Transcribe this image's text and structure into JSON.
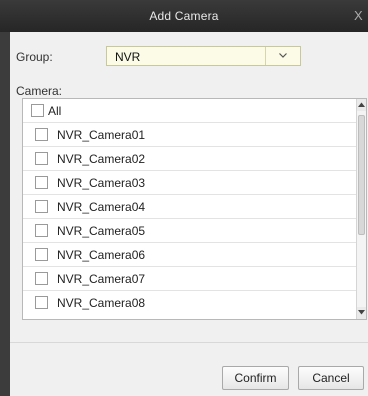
{
  "dialog": {
    "title": "Add Camera",
    "close_glyph": "X"
  },
  "group": {
    "label": "Group:",
    "value": "NVR"
  },
  "camera": {
    "label": "Camera:",
    "all_label": "All",
    "items": [
      "NVR_Camera01",
      "NVR_Camera02",
      "NVR_Camera03",
      "NVR_Camera04",
      "NVR_Camera05",
      "NVR_Camera06",
      "NVR_Camera07",
      "NVR_Camera08"
    ]
  },
  "buttons": {
    "confirm": "Confirm",
    "cancel": "Cancel"
  },
  "colors": {
    "titlebar": "#2f2f2f",
    "select_bg": "#fbfbe8"
  }
}
